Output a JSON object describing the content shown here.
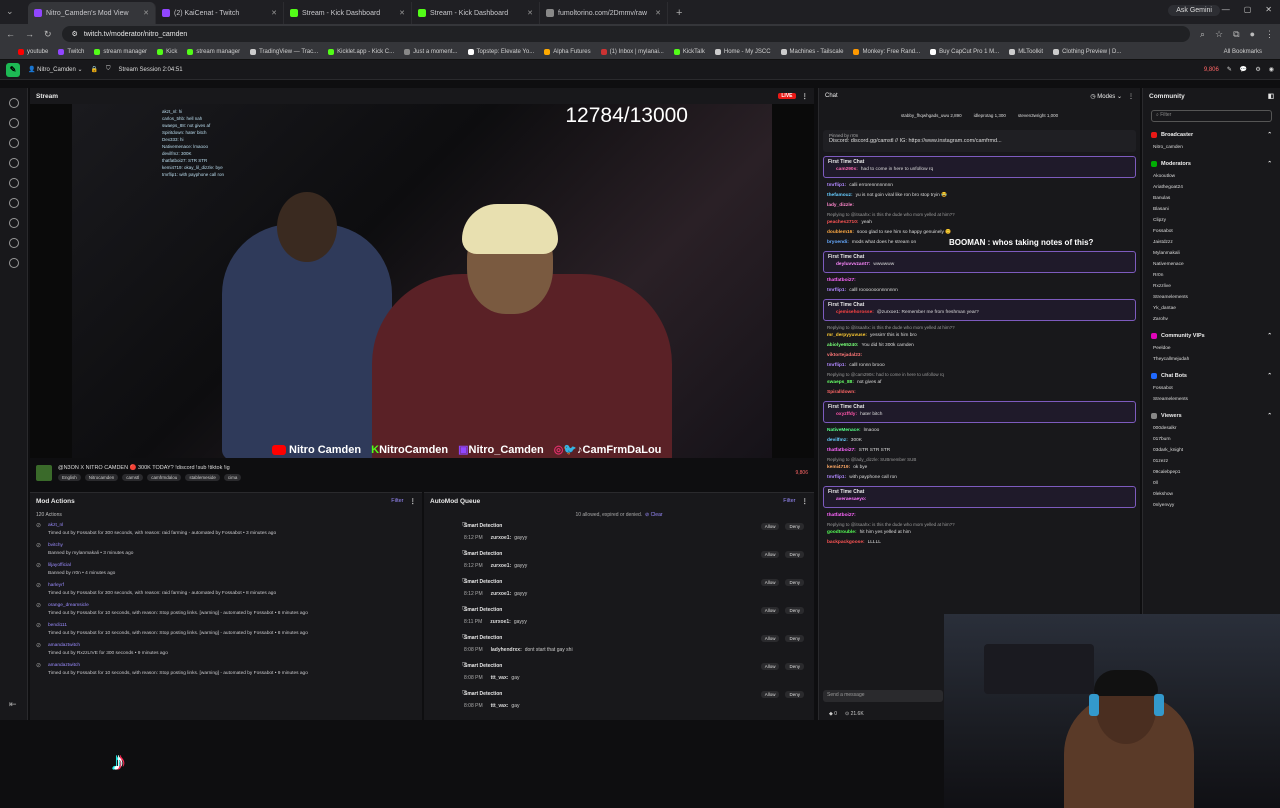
{
  "browser": {
    "tabs": [
      {
        "title": "Nitro_Camden's Mod View",
        "color": "#9146ff",
        "active": true
      },
      {
        "title": "(2) KaiCenat - Twitch",
        "color": "#9146ff",
        "active": false
      },
      {
        "title": "Stream - Kick Dashboard",
        "color": "#53fc18",
        "active": false
      },
      {
        "title": "Stream - Kick Dashboard",
        "color": "#53fc18",
        "active": false
      },
      {
        "title": "fumoltorino.com/2Dmmv/raw",
        "color": "#888888",
        "active": false
      }
    ],
    "gemini_label": "Ask Gemini",
    "url": "twitch.tv/moderator/nitro_camden",
    "bookmarks": [
      "youtube",
      "Twitch",
      "stream manager",
      "Kick",
      "stream manager",
      "TradingView — Trac...",
      "Kicklet.app - Kick C...",
      "Just a moment...",
      "Topstep: Elevate Yo...",
      "Alpha Futures",
      "(1) Inbox | mylanai...",
      "KickTalk",
      "Home - My JSCC",
      "Machines - Tailscale",
      "Monkey: Free Rand...",
      "Buy CapCut Pro 1 M...",
      "MLToolkit",
      "Clothing Preview | D..."
    ],
    "all_bookmarks": "All Bookmarks"
  },
  "twitch": {
    "channel": "Nitro_Camden",
    "session": "Stream Session 2:04:51",
    "viewer_count_top": "9,806"
  },
  "stream": {
    "header": "Stream",
    "live_badge": "LIVE",
    "counter": "12784/13000",
    "socials": [
      "Nitro Camden",
      "NitroCamden",
      "Nitro_Camden",
      "CamFrmDaLou"
    ],
    "overlay_chat": [
      "akzt_nl: hi",
      "carlos_5hb: hell nah",
      "swaeps_88: not gives af",
      "Spiritdown: hater bitch",
      "Dex333: hi",
      "Nativemenace: lmaooo",
      "devilfmz: 300K",
      "thatfatboi27: STR STR",
      "kemi4719: okay_lil_dizzle: bye",
      "tmrflip1: with payphone call ron"
    ],
    "title": "@N3ON X NITRO CAMDEN 🔴 300K TODAY? !discord !sub !tiktok !ig",
    "tags": [
      "English",
      "Nitrocamden",
      "camstl",
      "camfrmdalou",
      "stablemeside",
      "cima"
    ],
    "viewers": "9,806"
  },
  "mod_actions": {
    "header": "Mod Actions",
    "filter": "Filter",
    "count": "120 Actions",
    "items": [
      {
        "user": "akzt_nl",
        "desc": "Timed out by Fossabot for 300 seconds, with reason: raid farming - automated by Fossabot • 3 minutes ago"
      },
      {
        "user": "bvitchy",
        "desc": "Banned by mylanmakali • 3 minutes ago"
      },
      {
        "user": "liljayofficial",
        "desc": "Banned by rr0n • 4 minutes ago"
      },
      {
        "user": "harleyrf",
        "desc": "Timed out by Fossabot for 300 seconds, with reason: raid farming - automated by Fossabot • 8 minutes ago"
      },
      {
        "user": "orange_dreamsicle",
        "desc": "Timed out by Fossabot for 10 seconds, with reason: Stop posting links. [warning] - automated by Fossabot • 8 minutes ago"
      },
      {
        "user": "bendi111",
        "desc": "Timed out by Fossabot for 10 seconds, with reason: Stop posting links. [warning] - automated by Fossabot • 8 minutes ago"
      },
      {
        "user": "amandaztwitch",
        "desc": "Timed out by RxzzLIVE for 300 seconds • 9 minutes ago"
      },
      {
        "user": "amandaztwitch",
        "desc": "Timed out by Fossabot for 10 seconds, with reason: Stop posting links. [warning] - automated by Fossabot • 9 minutes ago"
      }
    ]
  },
  "automod": {
    "header": "AutoMod Queue",
    "filter": "Filter",
    "status": "10 allowed, expired or denied.",
    "clear": "Clear",
    "allow": "Allow",
    "deny": "Deny",
    "items": [
      {
        "title": "Smart Detection",
        "time": "8:12 PM",
        "user": "zurxoe1:",
        "msg": "gayyy"
      },
      {
        "title": "Smart Detection",
        "time": "8:12 PM",
        "user": "zurxoe1:",
        "msg": "gayyy"
      },
      {
        "title": "Smart Detection",
        "time": "8:12 PM",
        "user": "zurxoe1:",
        "msg": "gayyy"
      },
      {
        "title": "Smart Detection",
        "time": "8:11 PM",
        "user": "zurxoe1:",
        "msg": "gayyy"
      },
      {
        "title": "Smart Detection",
        "time": "8:08 PM",
        "user": "ladyhendrxx:",
        "msg": "dont start that gay shi"
      },
      {
        "title": "Smart Detection",
        "time": "8:08 PM",
        "user": "ttt_vax:",
        "msg": "gay"
      },
      {
        "title": "Smart Detection",
        "time": "8:08 PM",
        "user": "ttt_vax:",
        "msg": "gay"
      }
    ]
  },
  "chat": {
    "header": "Chat",
    "modes": "Modes",
    "top": [
      "stabby_fhqwhgads_uwu 2,890",
      "idleprotag 1,300",
      "steven3wright 1,000"
    ],
    "pinned_by": "Pinned by rr0n",
    "pinned_text": "Discord: discord.gg/camstl // IG: https://www.instagram.com/camfrmd...",
    "first_time_label": "First Time Chat",
    "messages": [
      {
        "user": "cam290s:",
        "text": "had to come in here to unfollow rq",
        "color": "#ff69b4",
        "ftc": true
      },
      {
        "user": "tmrflip1:",
        "text": "calli errorennnnnnnn",
        "color": "#b088ff"
      },
      {
        "user": "thefamouz:",
        "text": "yu is not goin viral like ron bro stop tryin 😂",
        "color": "#66ccff"
      },
      {
        "user": "lady_dizzle:",
        "text": "",
        "color": "#ff88cc"
      },
      {
        "reply": "Replying to @itsaahx: is this the dude who mom yelled at him??"
      },
      {
        "user": "peaches2710:",
        "text": "yeah",
        "color": "#ff5555"
      },
      {
        "user": "doublem16:",
        "text": "sooo glad to see him so happy genuinely 😊",
        "color": "#ffaa44"
      },
      {
        "user": "bryoendi:",
        "text": "mods what does he stream on",
        "color": "#66aaff"
      },
      {
        "user": "deyluvvvzant7:",
        "text": "wwwwww",
        "color": "#ff88ff",
        "ftc": true
      },
      {
        "user": "thatfatboi27:",
        "text": "",
        "color": "#ff66ff"
      },
      {
        "user": "tmrflip1:",
        "text": "calll rooooooonnnnnnn",
        "color": "#b088ff"
      },
      {
        "user": "cjemisehorosse:",
        "text": "@zurxoe1: Remember me from freshman year?",
        "color": "#ff4444",
        "ftc": true
      },
      {
        "reply": "Replying to @itsaahx: is this the dude who mom yelled at him??"
      },
      {
        "user": "mr_derpyyuvuse:",
        "text": "yessirrr this is him bro",
        "color": "#ffcc33"
      },
      {
        "user": "abiolye65240:",
        "text": "You did hit 300k camden",
        "color": "#77ff77"
      },
      {
        "user": "viktortejadal23:",
        "text": "",
        "color": "#ff7777"
      },
      {
        "user": "tmrflip1:",
        "text": "calll ronnn brooo",
        "color": "#b088ff"
      },
      {
        "reply": "Replying to @cam290s: had to come in here to unfollow rq"
      },
      {
        "user": "swaeps_88:",
        "text": "not gives af",
        "color": "#66ff66"
      },
      {
        "user": "Spiralldown:",
        "text": "",
        "color": "#ff6666"
      },
      {
        "user": "oxyzffdy:",
        "text": "hater bitch",
        "color": "#ff55aa",
        "ftc": true
      },
      {
        "user": "NativeMenace:",
        "text": "lmaooo",
        "color": "#55ff88"
      },
      {
        "user": "devilfmz:",
        "text": "300K",
        "color": "#66ccff"
      },
      {
        "user": "thatfatboi27:",
        "text": "STR STR STR",
        "color": "#ff66ff"
      },
      {
        "reply": "Replying to @lady_dizzle: SUBmember SUB"
      },
      {
        "user": "kemi4719:",
        "text": "ok bye",
        "color": "#ffaa66"
      },
      {
        "user": "tmrflip1:",
        "text": "with payphone call ron",
        "color": "#b088ff"
      },
      {
        "user": "averaesaeyo:",
        "text": "",
        "color": "#ff77ff",
        "ftc": true
      },
      {
        "user": "thatfatboi27:",
        "text": "",
        "color": "#ff66ff"
      },
      {
        "reply": "Replying to @itsaahx: is this the dude who mom yelled at him??"
      },
      {
        "user": "goodtrouble:",
        "text": "hit him yes yelled at him",
        "color": "#55ff55"
      },
      {
        "user": "backpackgoose:",
        "text": "LLLLL",
        "color": "#ff5555"
      }
    ],
    "overlay_message": "BOOMAN : whos taking notes of this?",
    "input_placeholder": "Send a message",
    "footer_points": "0",
    "footer_count": "21.6K"
  },
  "community": {
    "header": "Community",
    "filter_placeholder": "Filter",
    "sections": [
      {
        "title": "Broadcaster",
        "color": "#e91916",
        "users": [
          "Nitro_camden"
        ]
      },
      {
        "title": "Moderators",
        "color": "#00ad03",
        "users": [
          "Akooutlow",
          "Ariathegoat24",
          "Banulas",
          "Blasani",
          "Clipzy",
          "Fossabot",
          "Jaistdzzz",
          "Mylanmakali",
          "Nativemenace",
          "Rr0n",
          "Rxzzlive",
          "Streamelements",
          "Yk_dantae",
          "Zarohv"
        ]
      },
      {
        "title": "Community VIPs",
        "color": "#e005b9",
        "users": [
          "Peeldoe",
          "Theycallmejudah"
        ]
      },
      {
        "title": "Chat Bots",
        "color": "#1f69ff",
        "users": [
          "Fossabot",
          "Streamelements"
        ]
      },
      {
        "title": "Viewers",
        "color": "#888888",
        "users": [
          "000desalkr",
          "017burn",
          "03dark_knight",
          "01zezz",
          "09calebpep1",
          "0ll",
          "0lekshow",
          "0nlyenvyy"
        ]
      }
    ]
  }
}
